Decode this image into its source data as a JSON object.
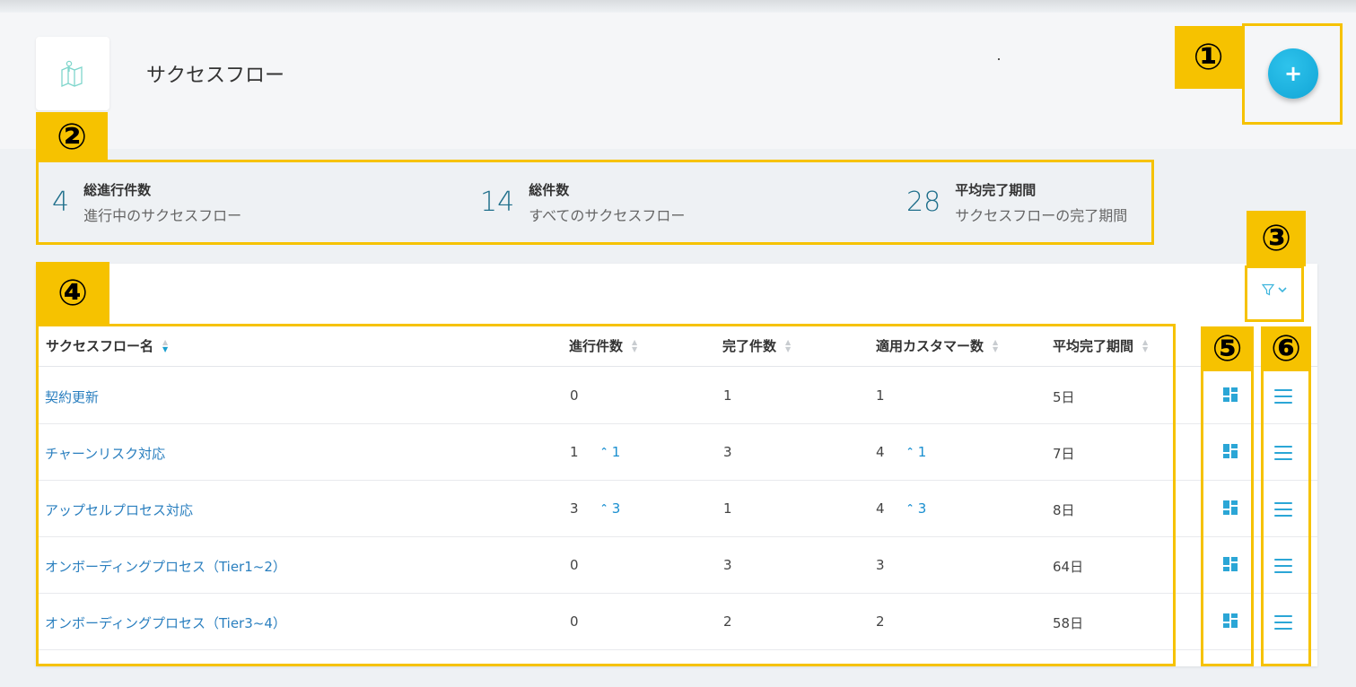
{
  "header": {
    "title": "サクセスフロー",
    "add_label": "+"
  },
  "annotations": [
    "①",
    "②",
    "③",
    "④",
    "⑤",
    "⑥"
  ],
  "stats": [
    {
      "value": "4",
      "title": "総進行件数",
      "subtitle": "進行中のサクセスフロー"
    },
    {
      "value": "14",
      "title": "総件数",
      "subtitle": "すべてのサクセスフロー"
    },
    {
      "value": "28",
      "title": "平均完了期間",
      "subtitle": "サクセスフローの完了期間"
    }
  ],
  "filter": {
    "icon": "filter-icon",
    "chevron": "⌄"
  },
  "table": {
    "columns": [
      "サクセスフロー名",
      "進行件数",
      "完了件数",
      "適用カスタマー数",
      "平均完了期間"
    ],
    "sorted_column": "サクセスフロー名",
    "rows": [
      {
        "name": "契約更新",
        "in_progress": "0",
        "in_progress_delta": "",
        "completed": "1",
        "customers": "1",
        "customers_delta": "",
        "avg": "5日"
      },
      {
        "name": "チャーンリスク対応",
        "in_progress": "1",
        "in_progress_delta": "1",
        "completed": "3",
        "customers": "4",
        "customers_delta": "1",
        "avg": "7日"
      },
      {
        "name": "アップセルプロセス対応",
        "in_progress": "3",
        "in_progress_delta": "3",
        "completed": "1",
        "customers": "4",
        "customers_delta": "3",
        "avg": "8日"
      },
      {
        "name": "オンボーディングプロセス（Tier1~2）",
        "in_progress": "0",
        "in_progress_delta": "",
        "completed": "3",
        "customers": "3",
        "customers_delta": "",
        "avg": "64日"
      },
      {
        "name": "オンボーディングプロセス（Tier3~4）",
        "in_progress": "0",
        "in_progress_delta": "",
        "completed": "2",
        "customers": "2",
        "customers_delta": "",
        "avg": "58日"
      }
    ]
  },
  "colors": {
    "accent": "#12a5d6",
    "annotation": "#f6c200",
    "link": "#2a7fbf",
    "stat_number": "#1f6f8b"
  }
}
